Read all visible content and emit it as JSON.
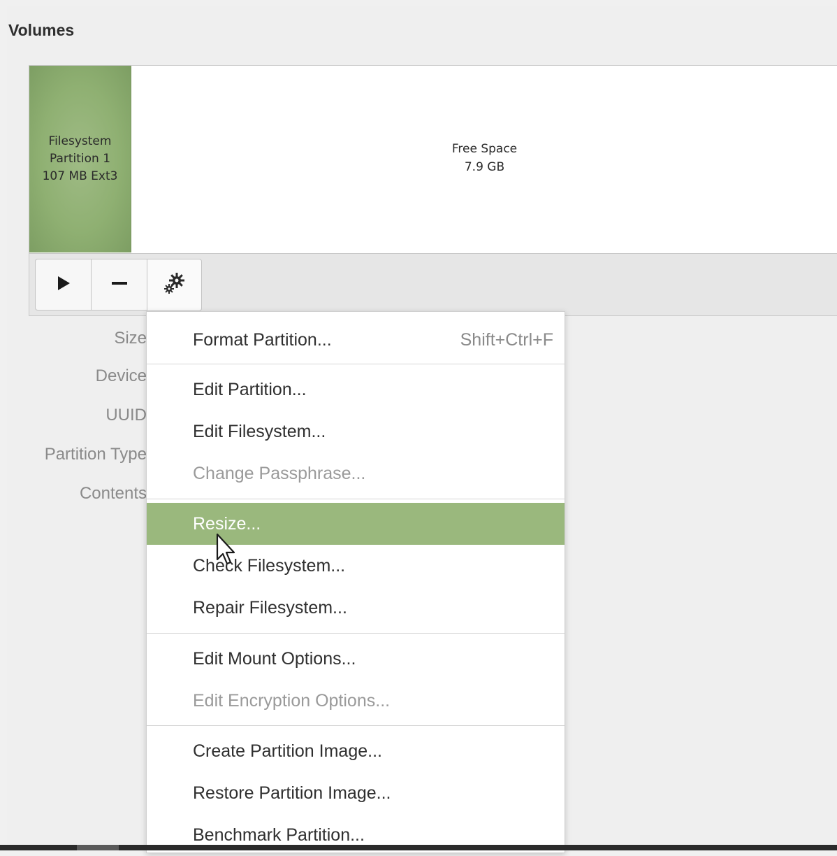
{
  "section": {
    "title": "Volumes"
  },
  "partitions": [
    {
      "label": "Filesystem\nPartition 1\n107 MB Ext3",
      "fill_color": "#8fb072"
    },
    {
      "label": "Free Space\n7.9 GB",
      "fill_color": "#ffffff"
    }
  ],
  "toolbar": {
    "buttons": [
      {
        "icon": "play-icon",
        "tooltip": ""
      },
      {
        "icon": "minus-icon",
        "tooltip": ""
      },
      {
        "icon": "gears-icon",
        "tooltip": ""
      }
    ]
  },
  "properties": {
    "labels": [
      "Size",
      "Device",
      "UUID",
      "Partition Type",
      "Contents"
    ]
  },
  "context_menu": {
    "highlight_color": "#9ab87d",
    "items": [
      {
        "label": "Format Partition...",
        "accel": "Shift+Ctrl+F",
        "enabled": true
      },
      {
        "label": "Edit Partition...",
        "accel": "",
        "enabled": true
      },
      {
        "label": "Edit Filesystem...",
        "accel": "",
        "enabled": true
      },
      {
        "label": "Change Passphrase...",
        "accel": "",
        "enabled": false
      },
      {
        "label": "Resize...",
        "accel": "",
        "enabled": true,
        "highlighted": true
      },
      {
        "label": "Check Filesystem...",
        "accel": "",
        "enabled": true
      },
      {
        "label": "Repair Filesystem...",
        "accel": "",
        "enabled": true
      },
      {
        "label": "Edit Mount Options...",
        "accel": "",
        "enabled": true
      },
      {
        "label": "Edit Encryption Options...",
        "accel": "",
        "enabled": false
      },
      {
        "label": "Create Partition Image...",
        "accel": "",
        "enabled": true
      },
      {
        "label": "Restore Partition Image...",
        "accel": "",
        "enabled": true
      },
      {
        "label": "Benchmark Partition...",
        "accel": "",
        "enabled": true
      }
    ]
  }
}
